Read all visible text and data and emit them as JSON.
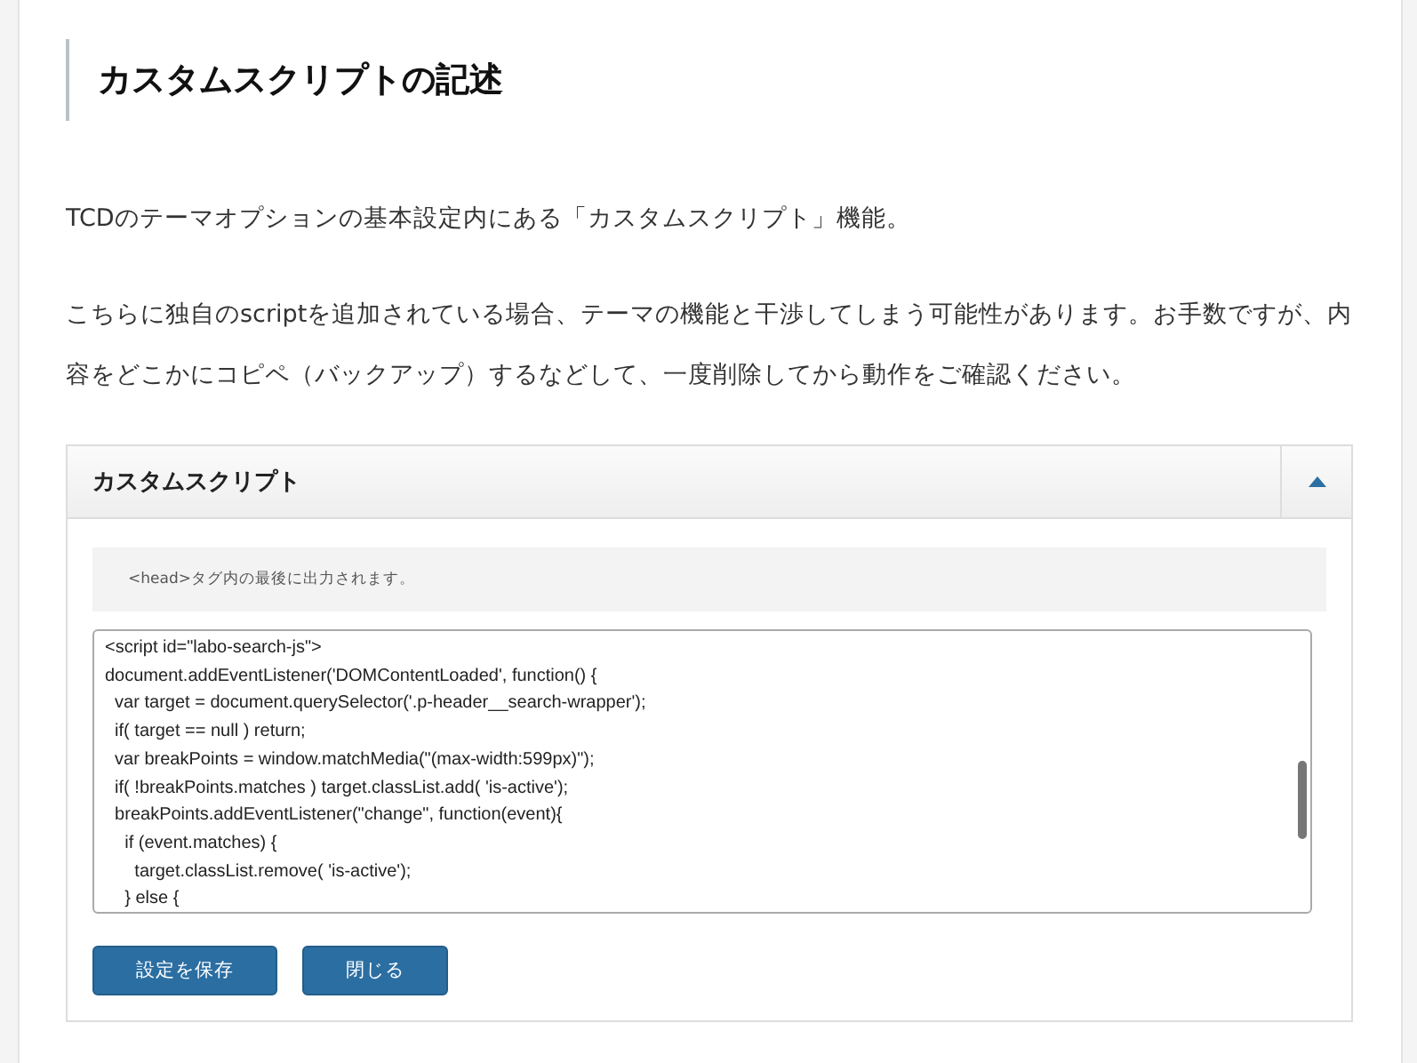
{
  "heading": "カスタムスクリプトの記述",
  "paragraphs": [
    "TCDのテーマオプションの基本設定内にある「カスタムスクリプト」機能。",
    "こちらに独自のscriptを追加されている場合、テーマの機能と干渉してしまう可能性があります。お手数ですが、内容をどこかにコピペ（バックアップ）するなどして、一度削除してから動作をご確認ください。"
  ],
  "panel": {
    "title": "カスタムスクリプト",
    "expanded": true,
    "note": "<head>タグ内の最後に出力されます。",
    "code_lines": [
      "<script id=\"labo-search-js\">",
      "document.addEventListener('DOMContentLoaded', function() {",
      "  var target = document.querySelector('.p-header__search-wrapper');",
      "  if( target == null ) return;",
      "  var breakPoints = window.matchMedia(\"(max-width:599px)\");",
      "  if( !breakPoints.matches ) target.classList.add( 'is-active');",
      "  breakPoints.addEventListener(\"change\", function(event){",
      "    if (event.matches) {",
      "      target.classList.remove( 'is-active');",
      "    } else {"
    ],
    "buttons": [
      "設定を保存",
      "閉じる"
    ]
  }
}
